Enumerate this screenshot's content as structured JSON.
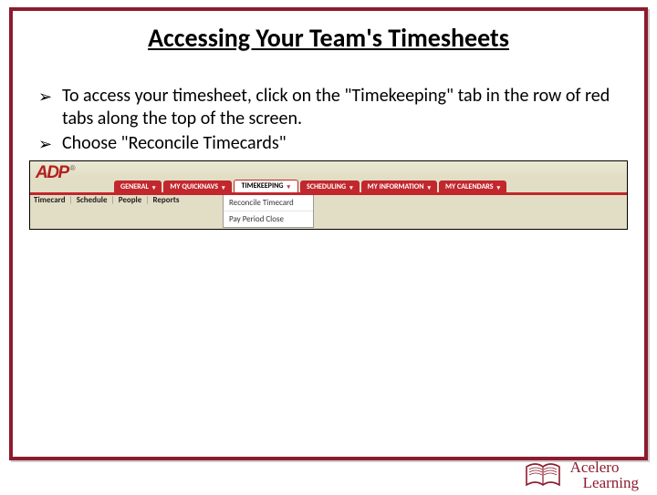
{
  "title": "Accessing Your Team's Timesheets",
  "bullets": [
    "To access your timesheet, click on the \"Timekeeping\" tab in the row of red tabs along the top of the screen.",
    "Choose \"Reconcile Timecards\""
  ],
  "screenshot": {
    "logo": "ADP",
    "tabs": {
      "general": "GENERAL",
      "quicknavs": "MY QUICKNAVS",
      "timekeeping": "TIMEKEEPING",
      "scheduling": "SCHEDULING",
      "myinfo": "MY INFORMATION",
      "mycal": "MY CALENDARS"
    },
    "subnav": {
      "timecard": "Timecard",
      "schedule": "Schedule",
      "people": "People",
      "reports": "Reports"
    },
    "dropdown": {
      "item1": "Reconcile Timecard",
      "item2": "Pay Period Close"
    }
  },
  "footer": {
    "line1": "Acelero",
    "line2": "Learning"
  }
}
